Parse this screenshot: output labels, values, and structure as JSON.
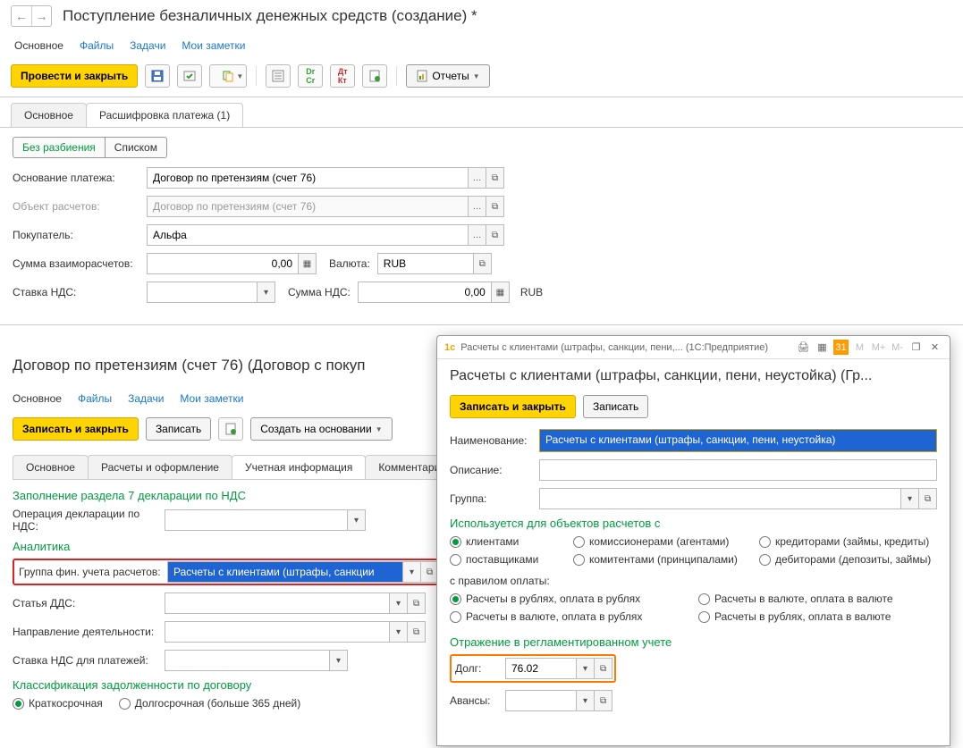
{
  "win1": {
    "title": "Поступление безналичных денежных средств (создание) *",
    "nav": {
      "main": "Основное",
      "files": "Файлы",
      "tasks": "Задачи",
      "notes": "Мои заметки"
    },
    "toolbar": {
      "post_close": "Провести и закрыть",
      "reports": "Отчеты"
    },
    "tabs": {
      "main": "Основное",
      "decode": "Расшифровка платежа (1)"
    },
    "mode": {
      "nosplit": "Без разбиения",
      "list": "Списком"
    },
    "fields": {
      "basis_label": "Основание платежа:",
      "basis_value": "Договор по претензиям (счет 76)",
      "object_label": "Объект расчетов:",
      "object_value": "Договор по претензиям (счет 76)",
      "buyer_label": "Покупатель:",
      "buyer_value": "Альфа",
      "sum_label": "Сумма взаиморасчетов:",
      "sum_value": "0,00",
      "currency_label": "Валюта:",
      "currency_value": "RUB",
      "vat_rate_label": "Ставка НДС:",
      "vat_sum_label": "Сумма НДС:",
      "vat_sum_value": "0,00",
      "vat_currency": "RUB"
    }
  },
  "win2": {
    "title": "Договор по претензиям (счет 76) (Договор с покуп",
    "nav": {
      "main": "Основное",
      "files": "Файлы",
      "tasks": "Задачи",
      "notes": "Мои заметки"
    },
    "toolbar": {
      "save_close": "Записать и закрыть",
      "save": "Записать",
      "create_on": "Создать на основании"
    },
    "tabs": {
      "t1": "Основное",
      "t2": "Расчеты и оформление",
      "t3": "Учетная информация",
      "t4": "Комментари"
    },
    "sec7": "Заполнение раздела 7 декларации по НДС",
    "decl_op_label": "Операция декларации по НДС:",
    "analytics": "Аналитика",
    "group_label": "Группа фин. учета расчетов:",
    "group_value": "Расчеты с клиентами (штрафы, санкции",
    "dds_label": "Статья ДДС:",
    "activity_label": "Направление деятельности:",
    "vat_pay_label": "Ставка НДС для платежей:",
    "class_header": "Классификация задолженности по договору",
    "radio_short": "Краткосрочная",
    "radio_long": "Долгосрочная (больше 365 дней)"
  },
  "modal": {
    "tb_title": "Расчеты с клиентами (штрафы, санкции, пени,... (1С:Предприятие)",
    "title": "Расчеты с клиентами (штрафы, санкции, пени, неустойка) (Гр...",
    "save_close": "Записать и закрыть",
    "save": "Записать",
    "name_label": "Наименование:",
    "name_value": "Расчеты с клиентами (штрафы, санкции, пени, неустойка)",
    "desc_label": "Описание:",
    "group_label": "Группа:",
    "used_header": "Используется для объектов расчетов с",
    "r_clients": "клиентами",
    "r_commiss": "комиссионерами (агентами)",
    "r_cred": "кредиторами (займы, кредиты)",
    "r_supp": "поставщиками",
    "r_commit": "комитентами (принципалами)",
    "r_deb": "дебиторами (депозиты, займы)",
    "pay_rule_label": "с правилом оплаты:",
    "pr1": "Расчеты в рублях, оплата в рублях",
    "pr2": "Расчеты в валюте, оплата в валюте",
    "pr3": "Расчеты в валюте, оплата в рублях",
    "pr4": "Расчеты в рублях, оплата в валюте",
    "reg_header": "Отражение в регламентированном учете",
    "debt_label": "Долг:",
    "debt_value": "76.02",
    "advance_label": "Авансы:"
  }
}
